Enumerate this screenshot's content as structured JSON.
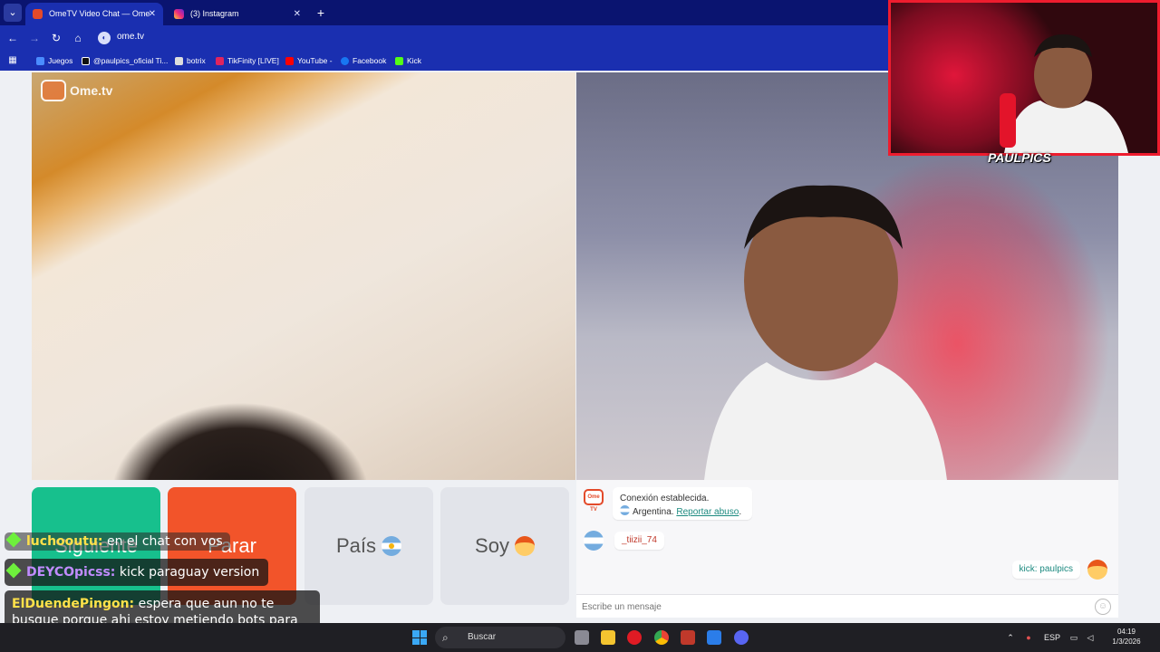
{
  "browser": {
    "tabs": [
      {
        "title": "OmeTV Video Chat — Ome",
        "active": true
      },
      {
        "title": "(3) Instagram",
        "active": false
      }
    ],
    "url": "ome.tv",
    "bookmarks": [
      {
        "label": "Juegos",
        "icon": "juegos-icon",
        "color": "#4a8cff"
      },
      {
        "label": "@paulpics_oficial Ti...",
        "icon": "tiktok-icon",
        "color": "#111111"
      },
      {
        "label": "botrix",
        "icon": "botrix-icon",
        "color": "#dddddd"
      },
      {
        "label": "TikFinity [LIVE]",
        "icon": "tikfinity-icon",
        "color": "#e0245e"
      },
      {
        "label": "YouTube -",
        "icon": "youtube-icon",
        "color": "#ff0000"
      },
      {
        "label": "Facebook",
        "icon": "facebook-icon",
        "color": "#1877f2"
      },
      {
        "label": "Kick",
        "icon": "kick-icon",
        "color": "#53fc18"
      }
    ]
  },
  "ometv": {
    "logo_text": "Ome.tv",
    "logo_badge": "Ome TV",
    "buttons": {
      "next": "Siguiente",
      "stop": "Parar",
      "country": "País",
      "me": "Soy"
    },
    "chat": {
      "system_message": "Conexión establecida.",
      "country": "Argentina.",
      "report_link": "Reportar abuso",
      "report_suffix": ".",
      "partner_name": "_tiizii_74",
      "my_message": "kick: paulpics",
      "input_placeholder": "Escribe un mensaje"
    }
  },
  "overlay": {
    "streamer_logo": "PAULPICS",
    "stream_chat": [
      {
        "user": "luchooutu:",
        "text": "en el chat con vos"
      },
      {
        "user": "DEYCOpicss:",
        "text": "kick paraguay version"
      },
      {
        "user": "ElDuendePingon:",
        "text": "espera que aun no te busque porque ahi estoy metiendo bots para que parezcas famoso"
      }
    ]
  },
  "taskbar": {
    "search_label": "Buscar",
    "language": "ESP",
    "time": "04:19",
    "date": "1/3/2026"
  },
  "colors": {
    "tab_strip": "#0a1470",
    "toolbar": "#1a2fb0",
    "next_button": "#17c08d",
    "stop_button": "#f2542a",
    "link_teal": "#1d8a80",
    "cam_border": "#ee1c2e"
  }
}
